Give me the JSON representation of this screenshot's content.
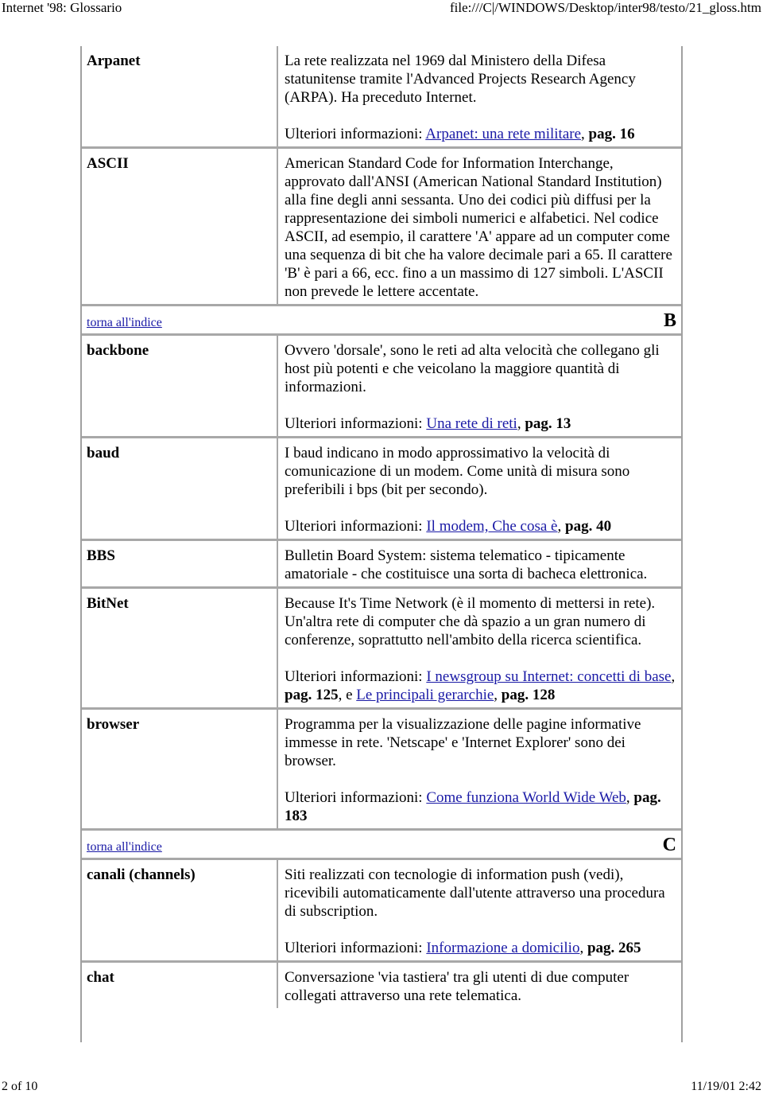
{
  "header": {
    "title": "Internet '98: Glossario",
    "url": "file:///C|/WINDOWS/Desktop/inter98/testo/21_gloss.htm"
  },
  "footer": {
    "page": "2 of 10",
    "timestamp": "11/19/01 2:42"
  },
  "more_info_label": "Ulteriori informazioni:",
  "index_link_label": "torna all'indice",
  "entries": {
    "arpanet": {
      "term": "Arpanet",
      "definition": "La rete realizzata nel 1969 dal Ministero della Difesa statunitense tramite l'Advanced Projects Research Agency (ARPA). Ha preceduto Internet.",
      "link1": "Arpanet: una rete militare",
      "page1": "pag. 16"
    },
    "ascii": {
      "term": "ASCII",
      "definition": "American Standard Code for Information Interchange, approvato dall'ANSI (American National Standard Institution) alla fine degli anni sessanta. Uno dei codici più diffusi per la rappresentazione dei simboli numerici e alfabetici. Nel codice ASCII, ad esempio, il carattere 'A' appare ad un computer come una sequenza di bit che ha valore decimale pari a 65. Il carattere 'B' è pari a 66, ecc. fino a un massimo di 127 simboli. L'ASCII non prevede le lettere accentate."
    },
    "section_b": {
      "letter": "B"
    },
    "backbone": {
      "term": "backbone",
      "definition": "Ovvero 'dorsale', sono le reti ad alta velocità che collegano gli host più potenti e che veicolano la maggiore quantità di informazioni.",
      "link1": "Una rete di reti",
      "page1": "pag. 13"
    },
    "baud": {
      "term": "baud",
      "definition": "I baud indicano in modo approssimativo la velocità di comunicazione di un modem. Come unità di misura sono preferibili i bps (bit per secondo).",
      "link1": "Il modem, Che cosa è",
      "page1": "pag. 40"
    },
    "bbs": {
      "term": "BBS",
      "definition": "Bulletin Board System: sistema telematico - tipicamente amatoriale - che costituisce una sorta di bacheca elettronica."
    },
    "bitnet": {
      "term": "BitNet",
      "definition": "Because It's Time Network (è il momento di mettersi in rete). Un'altra rete di computer che dà spazio a un gran numero di conferenze, soprattutto nell'ambito della ricerca scientifica.",
      "link1": "I newsgroup su Internet: concetti di base",
      "page1": "pag. 125",
      "joiner": ", e ",
      "link2": "Le principali gerarchie",
      "page2": "pag. 128"
    },
    "browser": {
      "term": "browser",
      "definition": "Programma per la visualizzazione delle pagine informative immesse in rete. 'Netscape' e 'Internet Explorer' sono dei browser.",
      "link1": "Come funziona World Wide Web",
      "page1": "pag. 183"
    },
    "section_c": {
      "letter": "C"
    },
    "canali": {
      "term": "canali (channels)",
      "definition": "Siti realizzati con tecnologie di information push (vedi), ricevibili automaticamente dall'utente attraverso una procedura di subscription.",
      "link1": "Informazione a domicilio",
      "page1": "pag. 265"
    },
    "chat": {
      "term": "chat",
      "definition": "Conversazione 'via tastiera' tra gli utenti di due computer collegati attraverso una rete telematica."
    }
  }
}
